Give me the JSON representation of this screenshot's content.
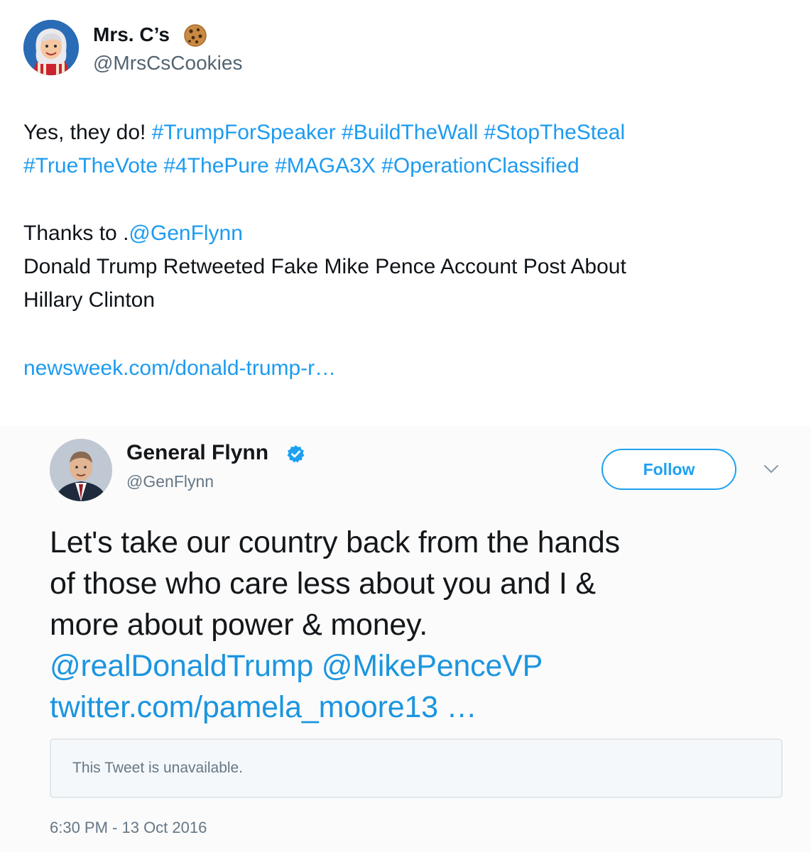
{
  "author": {
    "display_name": "Mrs. C’s",
    "handle": "@MrsCsCookies",
    "name_emoji": "cookie-icon"
  },
  "body": {
    "line1_text": "Yes, they do! ",
    "line1_tags": "#TrumpForSpeaker #BuildTheWall #StopTheSteal",
    "line2_tags": "#TrueTheVote #4ThePure #MAGA3X #OperationClassified",
    "thanks_prefix": "Thanks to .",
    "thanks_mention": "@GenFlynn",
    "headline_line1": "Donald Trump Retweeted Fake Mike Pence Account Post About",
    "headline_line2": "Hillary Clinton",
    "link": "newsweek.com/donald-trump-r…"
  },
  "embedded_tweet": {
    "name": "General Flynn",
    "handle": "@GenFlynn",
    "follow_label": "Follow",
    "text_line1": "Let's take our country back from the hands",
    "text_line2": "of those who care less about you and I &",
    "text_line3": "more about power & money.",
    "mentions": "@realDonaldTrump @MikePenceVP",
    "link": "twitter.com/pamela_moore13 …",
    "unavailable": "This Tweet is unavailable.",
    "timestamp": "6:30 PM - 13 Oct 2016"
  },
  "colors": {
    "link": "#1d9bf0",
    "embed_link": "#1b95e0",
    "verified": "#1da1f2"
  }
}
